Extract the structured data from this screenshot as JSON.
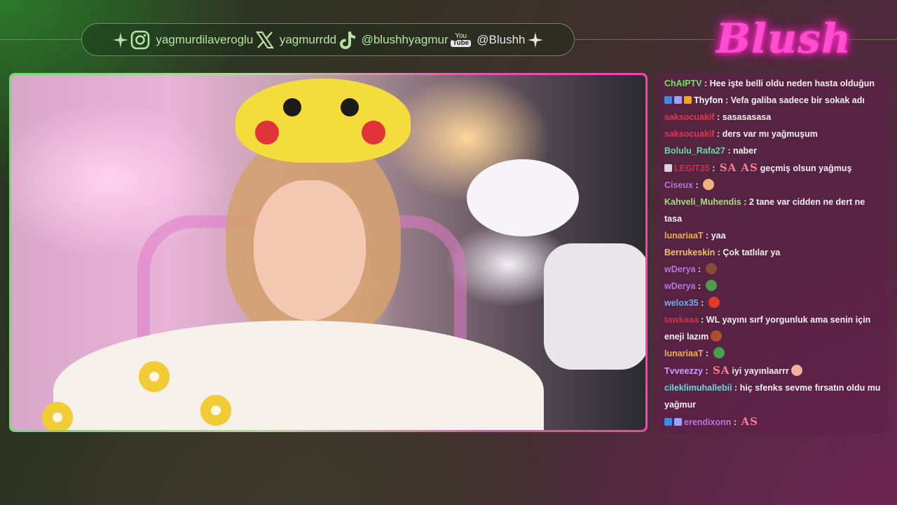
{
  "social": {
    "instagram": "yagmurdilaveroglu",
    "x": "yagmurrdd",
    "tiktok": "@blushhyagmur",
    "youtube_badge_top": "You",
    "youtube_badge_bottom": "Tube",
    "youtube": "@Blushh"
  },
  "brand": {
    "logo_text": "Blush",
    "color": "#ff4fd0"
  },
  "colors": {
    "frame_start": "#69e06c",
    "frame_end": "#ff3fae",
    "chat_bg": "#601e48"
  },
  "chat": {
    "messages": [
      {
        "user": "ChAIPTV",
        "user_color": "#6fe06b",
        "badges": [],
        "text": "Hee işte belli oldu neden hasta olduğun",
        "cut": true
      },
      {
        "user": "Thyfon",
        "user_color": "#ffffff",
        "badges": [
          "#3d8ce0",
          "#a0a0ff",
          "#f2a720"
        ],
        "text": "Vefa galiba sadece bir sokak adı"
      },
      {
        "user": "saksocuakif",
        "user_color": "#e0384f",
        "badges": [],
        "text": "sasasasasa"
      },
      {
        "user": "saksocuakif",
        "user_color": "#e0384f",
        "badges": [],
        "text": "ders var mı yağmuşum"
      },
      {
        "user": "Bolulu_Rafa27",
        "user_color": "#69d6a8",
        "badges": [],
        "text": "naber"
      },
      {
        "user": "LEGIT35",
        "user_color": "#d0304a",
        "badges": [
          "#e0d0e0"
        ],
        "emotes": [
          "SA",
          "AS"
        ],
        "text": "geçmiş olsun yağmuş"
      },
      {
        "user": "Ciseux",
        "user_color": "#b07ae0",
        "badges": [],
        "emote_icons": [
          "#f2b07a"
        ],
        "text": ""
      },
      {
        "user": "Kahveli_Muhendis",
        "user_color": "#9be37a",
        "badges": [],
        "text": "2 tane var cidden ne dert ne tasa"
      },
      {
        "user": "lunariaaT",
        "user_color": "#f0b040",
        "badges": [],
        "text": "yaa"
      },
      {
        "user": "Berrukeskin",
        "user_color": "#f2c26a",
        "badges": [],
        "text": "Çok tatlılar ya"
      },
      {
        "user": "wDerya",
        "user_color": "#b07ae0",
        "badges": [],
        "emote_icons": [
          "#8a4a3a"
        ],
        "text": ""
      },
      {
        "user": "wDerya",
        "user_color": "#b07ae0",
        "badges": [],
        "emote_icons": [
          "#4aa04a"
        ],
        "text": ""
      },
      {
        "user": "welox35",
        "user_color": "#6ab0f0",
        "badges": [],
        "emote_icons": [
          "#e03a2a"
        ],
        "text": ""
      },
      {
        "user": "tawkaaa",
        "user_color": "#d0304a",
        "badges": [],
        "text": "WL yayını sırf yorgunluk ama senin için eneji lazım",
        "emote_icons_after": [
          "#b0502a"
        ]
      },
      {
        "user": "lunariaaT",
        "user_color": "#f0b040",
        "badges": [],
        "emote_icons": [
          "#4aa04a"
        ],
        "text": ""
      },
      {
        "user": "Tvveezzy",
        "user_color": "#c8a0ff",
        "badges": [],
        "emotes": [
          "SA"
        ],
        "text": "iyi yayınlaarrr",
        "emote_icons_after": [
          "#f2b0a0"
        ]
      },
      {
        "user": "cileklimuhallebii",
        "user_color": "#6ad8d8",
        "badges": [],
        "text": "hiç sfenks sevme fırsatın oldu mu yağmur"
      },
      {
        "user": "erendixonn",
        "user_color": "#b07ae0",
        "badges": [
          "#3d8ce0",
          "#a0a0ff"
        ],
        "emotes": [
          "AS"
        ],
        "text": ""
      }
    ]
  }
}
